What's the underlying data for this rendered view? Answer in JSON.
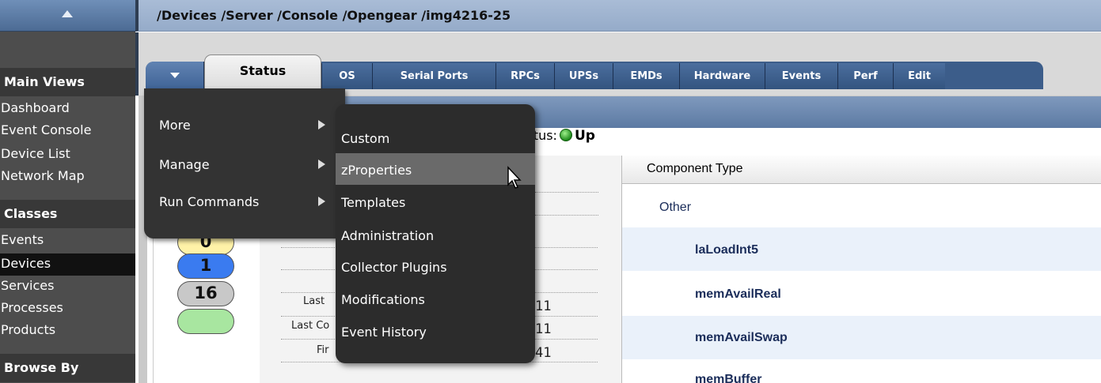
{
  "sidebar": {
    "main_views_heading": "Main Views",
    "main_views": [
      "Dashboard",
      "Event Console",
      "Device List",
      "Network Map"
    ],
    "classes_heading": "Classes",
    "classes": [
      "Events",
      "Devices",
      "Services",
      "Processes",
      "Products"
    ],
    "active_class": "Devices",
    "browse_heading": "Browse By"
  },
  "header": {
    "breadcrumb": "/Devices /Server /Console /Opengear /img4216-25"
  },
  "tabs": {
    "active": "Status",
    "items": [
      "OS",
      "Serial Ports",
      "RPCs",
      "UPSs",
      "EMDs",
      "Hardware",
      "Events",
      "Perf",
      "Edit"
    ]
  },
  "menu": {
    "items": [
      {
        "label": "More",
        "icon": "chevron-right-icon"
      },
      {
        "label": "Manage",
        "icon": "chevron-right-icon"
      },
      {
        "label": "Run Commands",
        "icon": "chevron-right-icon"
      }
    ],
    "submenu": [
      "Custom",
      "zProperties",
      "Templates",
      "Administration",
      "Collector Plugins",
      "Modifications",
      "Event History"
    ],
    "hovered": "zProperties"
  },
  "status": {
    "label_fragment": "atus:",
    "value": "Up",
    "color": "#2a9d1f"
  },
  "events": {
    "pills": [
      {
        "value": "0",
        "color": "#fff2a8"
      },
      {
        "value": "1",
        "color": "#3a7bf0"
      },
      {
        "value": "16",
        "color": "#c8c8c8"
      },
      {
        "value": "",
        "color": "#a8e6a0"
      }
    ]
  },
  "details": {
    "labels": [
      "Last",
      "Last Co",
      "Fir"
    ],
    "values": [
      "11",
      "11",
      "41"
    ]
  },
  "components": {
    "header": "Component Type",
    "group": "Other",
    "rows": [
      "laLoadInt5",
      "memAvailReal",
      "memAvailSwap",
      "memBuffer"
    ]
  }
}
